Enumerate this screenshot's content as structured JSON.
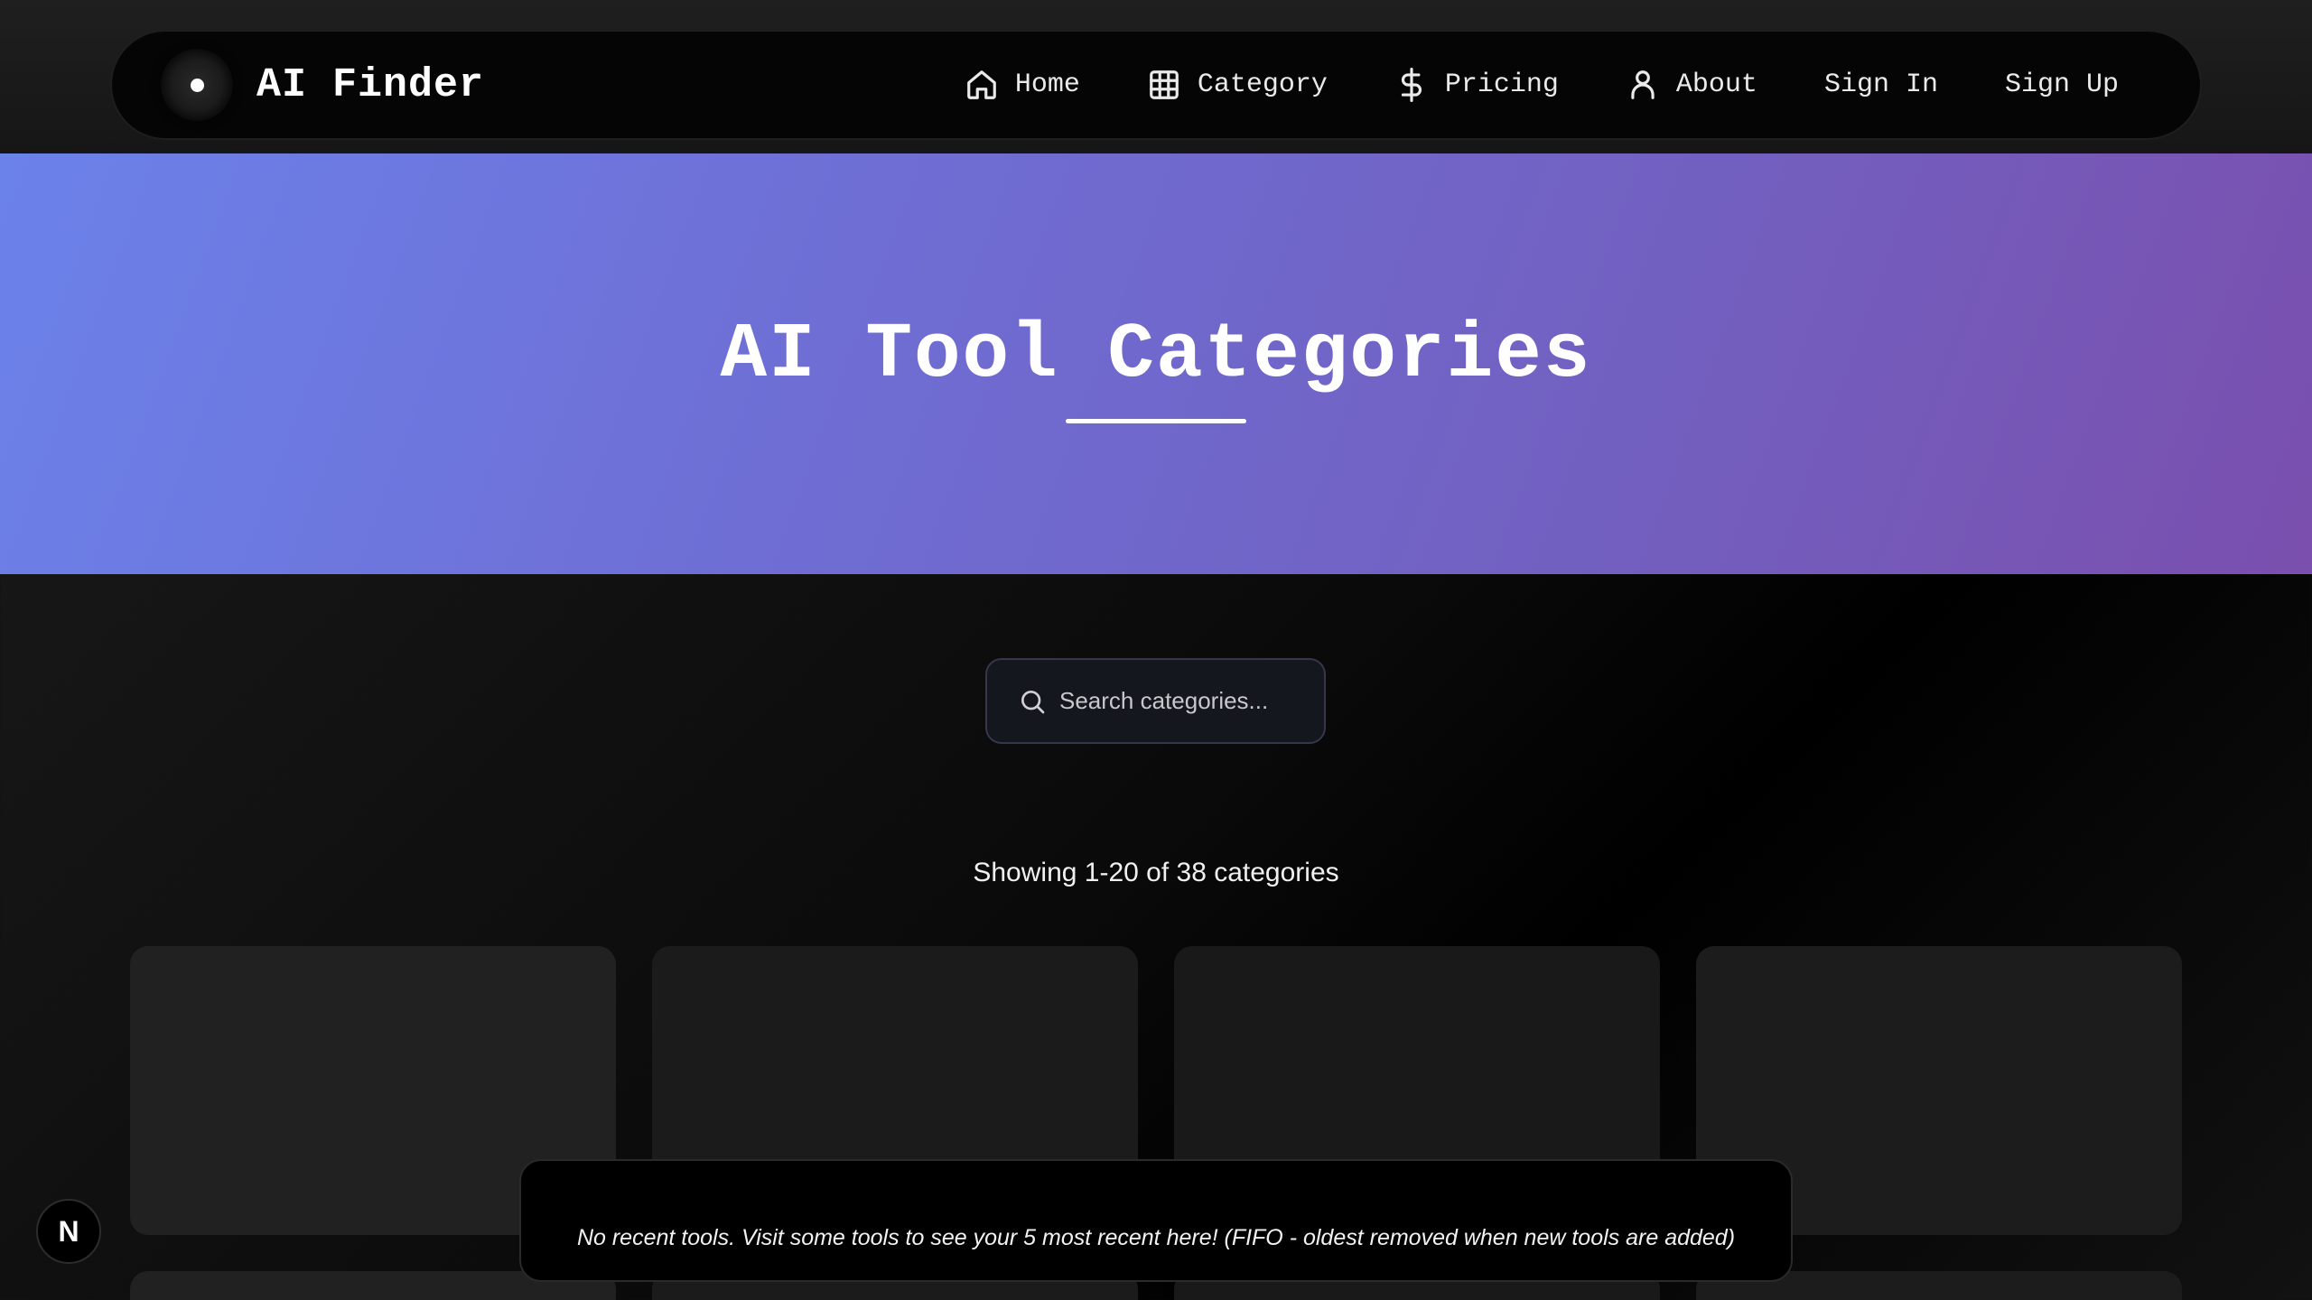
{
  "header": {
    "brand": "AI Finder",
    "nav": [
      {
        "label": "Home",
        "icon": "home-icon"
      },
      {
        "label": "Category",
        "icon": "grid-icon"
      },
      {
        "label": "Pricing",
        "icon": "dollar-icon"
      },
      {
        "label": "About",
        "icon": "user-icon"
      },
      {
        "label": "Sign In"
      },
      {
        "label": "Sign Up"
      }
    ]
  },
  "hero": {
    "title": "AI Tool Categories"
  },
  "search": {
    "placeholder": "Search categories...",
    "value": ""
  },
  "results": {
    "count_text": "Showing 1-20 of 38 categories"
  },
  "toast": {
    "message": "No recent tools. Visit some tools to see your 5 most recent here! (FIFO - oldest removed when new tools are added)"
  },
  "dev_badge": {
    "label": "N"
  },
  "colors": {
    "hero_gradient_start": "#6b82ea",
    "hero_gradient_end": "#7a4fae",
    "background": "#0a0a0a",
    "card": "#1d1d1d"
  }
}
